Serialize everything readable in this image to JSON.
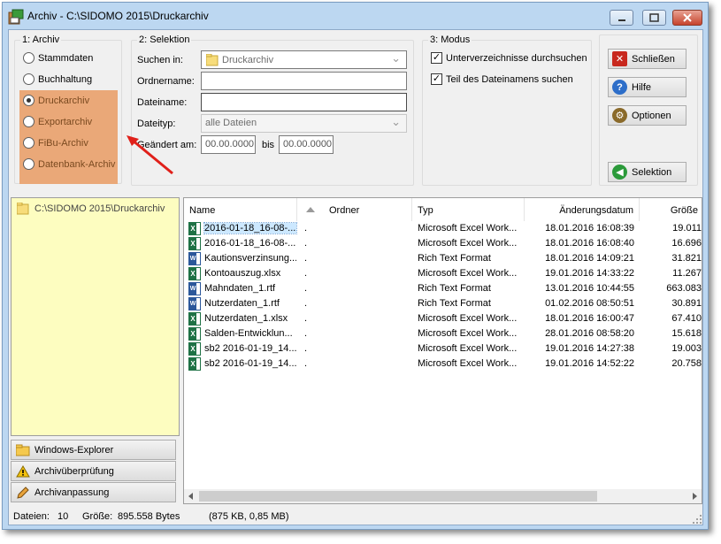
{
  "window": {
    "title": "Archiv - C:\\SIDOMO 2015\\Druckarchiv"
  },
  "archiv": {
    "title": "1: Archiv",
    "options": [
      {
        "label": "Stammdaten",
        "selected": false
      },
      {
        "label": "Buchhaltung",
        "selected": false
      },
      {
        "label": "Druckarchiv",
        "selected": true
      },
      {
        "label": "Exportarchiv",
        "selected": false
      },
      {
        "label": "FiBu-Archiv",
        "selected": false
      },
      {
        "label": "Datenbank-Archiv",
        "selected": false
      }
    ]
  },
  "selektion": {
    "title": "2: Selektion",
    "suchen_in_label": "Suchen in:",
    "suchen_in_value": "Druckarchiv",
    "ordnername_label": "Ordnername:",
    "ordnername_value": "",
    "dateiname_label": "Dateiname:",
    "dateiname_value": "",
    "dateityp_label": "Dateityp:",
    "dateityp_value": "alle Dateien",
    "geaendert_label": "Geändert am:",
    "date_from": "00.00.0000",
    "bis_label": "bis",
    "date_to": "00.00.0000"
  },
  "modus": {
    "title": "3: Modus",
    "check1": "Unterverzeichnisse durchsuchen",
    "check2": "Teil des Dateinamens suchen"
  },
  "buttons": {
    "schliessen": "Schließen",
    "hilfe": "Hilfe",
    "optionen": "Optionen",
    "selektion": "Selektion"
  },
  "tree": {
    "root": "C:\\SIDOMO 2015\\Druckarchiv"
  },
  "nav": {
    "explorer": "Windows-Explorer",
    "ueberpruefung": "Archivüberprüfung",
    "anpassung": "Archivanpassung"
  },
  "list": {
    "headers": {
      "name": "Name",
      "ordner": "Ordner",
      "typ": "Typ",
      "datum": "Änderungsdatum",
      "groesse": "Größe"
    },
    "rows": [
      {
        "icon": "excel",
        "name": "2016-01-18_16-08-...",
        "ordner": ".",
        "typ": "Microsoft Excel Work...",
        "datum": "18.01.2016 16:08:39",
        "groesse": "19.011"
      },
      {
        "icon": "excel",
        "name": "2016-01-18_16-08-...",
        "ordner": ".",
        "typ": "Microsoft Excel Work...",
        "datum": "18.01.2016 16:08:40",
        "groesse": "16.696"
      },
      {
        "icon": "word",
        "name": "Kautionsverzinsung....",
        "ordner": ".",
        "typ": "Rich Text Format",
        "datum": "18.01.2016 14:09:21",
        "groesse": "31.821"
      },
      {
        "icon": "excel",
        "name": "Kontoauszug.xlsx",
        "ordner": ".",
        "typ": "Microsoft Excel Work...",
        "datum": "19.01.2016 14:33:22",
        "groesse": "11.267"
      },
      {
        "icon": "word",
        "name": "Mahndaten_1.rtf",
        "ordner": ".",
        "typ": "Rich Text Format",
        "datum": "13.01.2016 10:44:55",
        "groesse": "663.083"
      },
      {
        "icon": "word",
        "name": "Nutzerdaten_1.rtf",
        "ordner": ".",
        "typ": "Rich Text Format",
        "datum": "01.02.2016 08:50:51",
        "groesse": "30.891"
      },
      {
        "icon": "excel",
        "name": "Nutzerdaten_1.xlsx",
        "ordner": ".",
        "typ": "Microsoft Excel Work...",
        "datum": "18.01.2016 16:00:47",
        "groesse": "67.410"
      },
      {
        "icon": "excel",
        "name": "Salden-Entwicklun...",
        "ordner": ".",
        "typ": "Microsoft Excel Work...",
        "datum": "28.01.2016 08:58:20",
        "groesse": "15.618"
      },
      {
        "icon": "excel",
        "name": "sb2 2016-01-19_14...",
        "ordner": ".",
        "typ": "Microsoft Excel Work...",
        "datum": "19.01.2016 14:27:38",
        "groesse": "19.003"
      },
      {
        "icon": "excel",
        "name": "sb2 2016-01-19_14...",
        "ordner": ".",
        "typ": "Microsoft Excel Work...",
        "datum": "19.01.2016 14:52:22",
        "groesse": "20.758"
      }
    ]
  },
  "status": {
    "dateien_label": "Dateien:",
    "dateien_value": "10",
    "groesse_label": "Größe:",
    "groesse_value": "895.558 Bytes",
    "groesse_detail": "(875 KB,  0,85 MB)"
  },
  "colors": {
    "highlight": "#eaa878",
    "arrow": "#e0201a",
    "tree_bg": "#fdfdc0"
  }
}
